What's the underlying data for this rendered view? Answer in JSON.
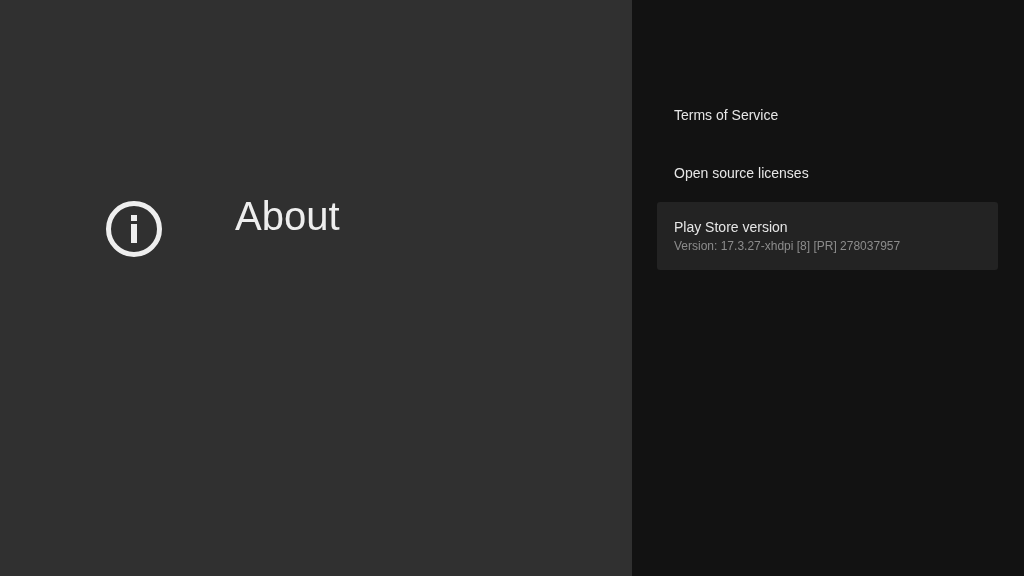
{
  "header": {
    "title": "About"
  },
  "items": [
    {
      "title": "Terms of Service",
      "selected": false
    },
    {
      "title": "Open source licenses",
      "selected": false
    },
    {
      "title": "Play Store version",
      "subtitle": "Version: 17.3.27-xhdpi [8] [PR] 278037957",
      "selected": true
    }
  ]
}
